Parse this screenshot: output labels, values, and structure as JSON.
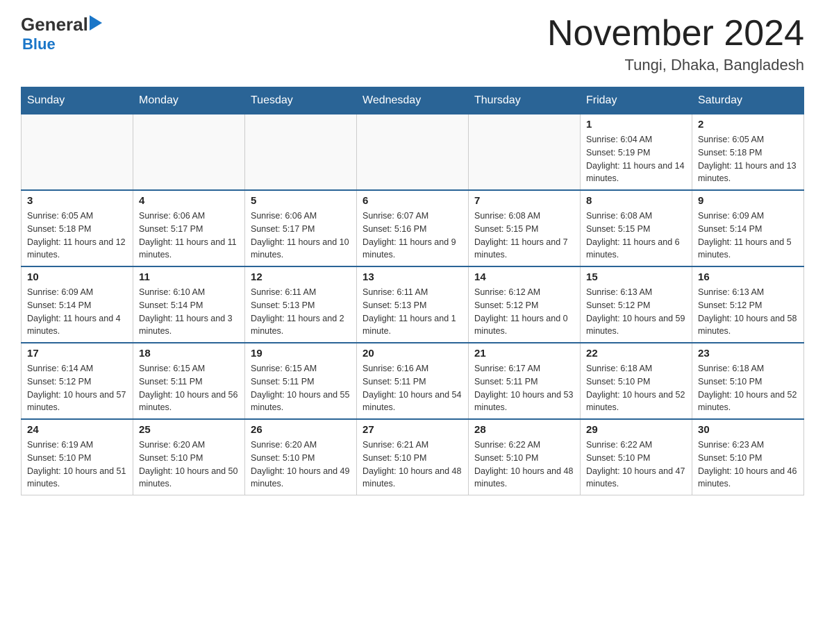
{
  "header": {
    "logo": {
      "general": "General",
      "blue": "Blue"
    },
    "title": "November 2024",
    "subtitle": "Tungi, Dhaka, Bangladesh"
  },
  "weekdays": [
    "Sunday",
    "Monday",
    "Tuesday",
    "Wednesday",
    "Thursday",
    "Friday",
    "Saturday"
  ],
  "weeks": [
    {
      "days": [
        {
          "num": "",
          "info": ""
        },
        {
          "num": "",
          "info": ""
        },
        {
          "num": "",
          "info": ""
        },
        {
          "num": "",
          "info": ""
        },
        {
          "num": "",
          "info": ""
        },
        {
          "num": "1",
          "info": "Sunrise: 6:04 AM\nSunset: 5:19 PM\nDaylight: 11 hours and 14 minutes."
        },
        {
          "num": "2",
          "info": "Sunrise: 6:05 AM\nSunset: 5:18 PM\nDaylight: 11 hours and 13 minutes."
        }
      ]
    },
    {
      "days": [
        {
          "num": "3",
          "info": "Sunrise: 6:05 AM\nSunset: 5:18 PM\nDaylight: 11 hours and 12 minutes."
        },
        {
          "num": "4",
          "info": "Sunrise: 6:06 AM\nSunset: 5:17 PM\nDaylight: 11 hours and 11 minutes."
        },
        {
          "num": "5",
          "info": "Sunrise: 6:06 AM\nSunset: 5:17 PM\nDaylight: 11 hours and 10 minutes."
        },
        {
          "num": "6",
          "info": "Sunrise: 6:07 AM\nSunset: 5:16 PM\nDaylight: 11 hours and 9 minutes."
        },
        {
          "num": "7",
          "info": "Sunrise: 6:08 AM\nSunset: 5:15 PM\nDaylight: 11 hours and 7 minutes."
        },
        {
          "num": "8",
          "info": "Sunrise: 6:08 AM\nSunset: 5:15 PM\nDaylight: 11 hours and 6 minutes."
        },
        {
          "num": "9",
          "info": "Sunrise: 6:09 AM\nSunset: 5:14 PM\nDaylight: 11 hours and 5 minutes."
        }
      ]
    },
    {
      "days": [
        {
          "num": "10",
          "info": "Sunrise: 6:09 AM\nSunset: 5:14 PM\nDaylight: 11 hours and 4 minutes."
        },
        {
          "num": "11",
          "info": "Sunrise: 6:10 AM\nSunset: 5:14 PM\nDaylight: 11 hours and 3 minutes."
        },
        {
          "num": "12",
          "info": "Sunrise: 6:11 AM\nSunset: 5:13 PM\nDaylight: 11 hours and 2 minutes."
        },
        {
          "num": "13",
          "info": "Sunrise: 6:11 AM\nSunset: 5:13 PM\nDaylight: 11 hours and 1 minute."
        },
        {
          "num": "14",
          "info": "Sunrise: 6:12 AM\nSunset: 5:12 PM\nDaylight: 11 hours and 0 minutes."
        },
        {
          "num": "15",
          "info": "Sunrise: 6:13 AM\nSunset: 5:12 PM\nDaylight: 10 hours and 59 minutes."
        },
        {
          "num": "16",
          "info": "Sunrise: 6:13 AM\nSunset: 5:12 PM\nDaylight: 10 hours and 58 minutes."
        }
      ]
    },
    {
      "days": [
        {
          "num": "17",
          "info": "Sunrise: 6:14 AM\nSunset: 5:12 PM\nDaylight: 10 hours and 57 minutes."
        },
        {
          "num": "18",
          "info": "Sunrise: 6:15 AM\nSunset: 5:11 PM\nDaylight: 10 hours and 56 minutes."
        },
        {
          "num": "19",
          "info": "Sunrise: 6:15 AM\nSunset: 5:11 PM\nDaylight: 10 hours and 55 minutes."
        },
        {
          "num": "20",
          "info": "Sunrise: 6:16 AM\nSunset: 5:11 PM\nDaylight: 10 hours and 54 minutes."
        },
        {
          "num": "21",
          "info": "Sunrise: 6:17 AM\nSunset: 5:11 PM\nDaylight: 10 hours and 53 minutes."
        },
        {
          "num": "22",
          "info": "Sunrise: 6:18 AM\nSunset: 5:10 PM\nDaylight: 10 hours and 52 minutes."
        },
        {
          "num": "23",
          "info": "Sunrise: 6:18 AM\nSunset: 5:10 PM\nDaylight: 10 hours and 52 minutes."
        }
      ]
    },
    {
      "days": [
        {
          "num": "24",
          "info": "Sunrise: 6:19 AM\nSunset: 5:10 PM\nDaylight: 10 hours and 51 minutes."
        },
        {
          "num": "25",
          "info": "Sunrise: 6:20 AM\nSunset: 5:10 PM\nDaylight: 10 hours and 50 minutes."
        },
        {
          "num": "26",
          "info": "Sunrise: 6:20 AM\nSunset: 5:10 PM\nDaylight: 10 hours and 49 minutes."
        },
        {
          "num": "27",
          "info": "Sunrise: 6:21 AM\nSunset: 5:10 PM\nDaylight: 10 hours and 48 minutes."
        },
        {
          "num": "28",
          "info": "Sunrise: 6:22 AM\nSunset: 5:10 PM\nDaylight: 10 hours and 48 minutes."
        },
        {
          "num": "29",
          "info": "Sunrise: 6:22 AM\nSunset: 5:10 PM\nDaylight: 10 hours and 47 minutes."
        },
        {
          "num": "30",
          "info": "Sunrise: 6:23 AM\nSunset: 5:10 PM\nDaylight: 10 hours and 46 minutes."
        }
      ]
    }
  ]
}
